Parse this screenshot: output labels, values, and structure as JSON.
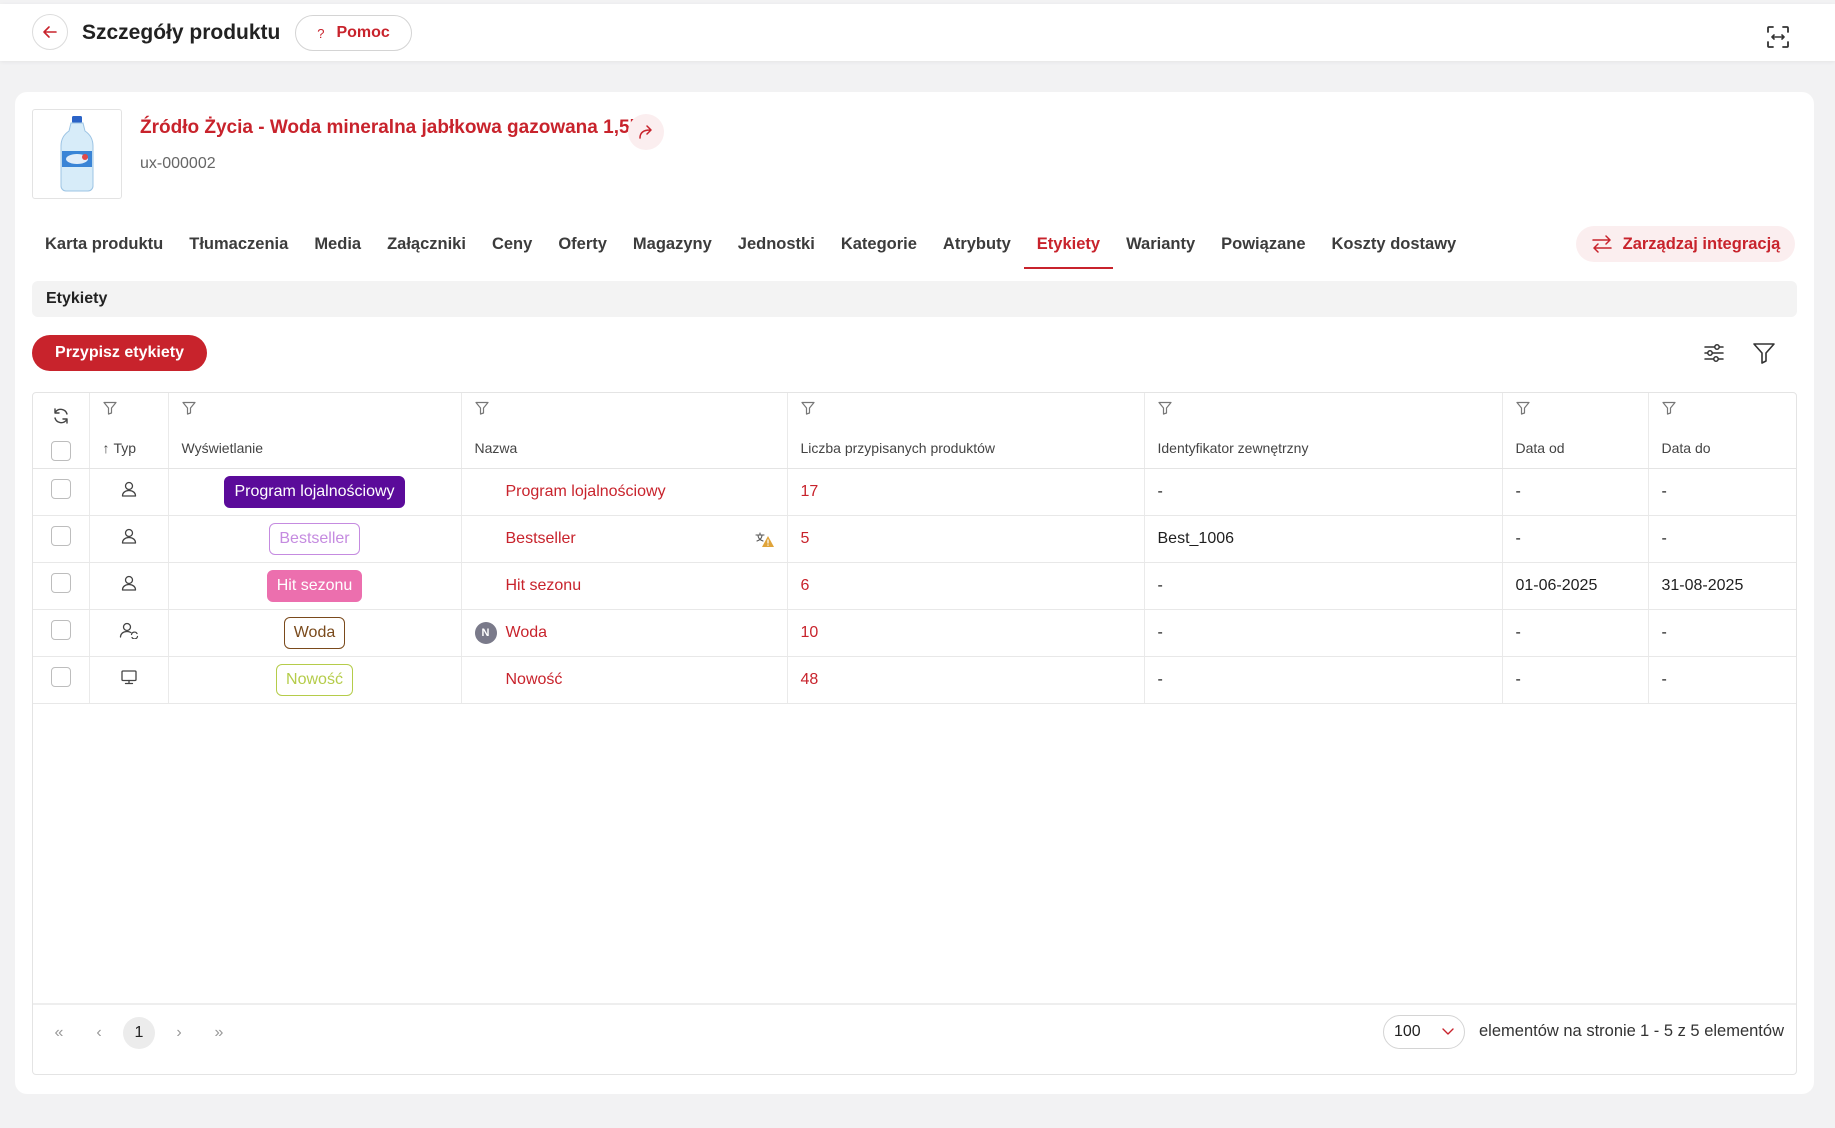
{
  "header": {
    "title": "Szczegóły produktu",
    "help_label": "Pomoc",
    "help_icon": "?"
  },
  "product": {
    "name": "Źródło Życia - Woda mineralna jabłkowa gazowana 1,5l",
    "sku": "ux-000002"
  },
  "tabs": [
    {
      "label": "Karta produktu"
    },
    {
      "label": "Tłumaczenia"
    },
    {
      "label": "Media"
    },
    {
      "label": "Załączniki"
    },
    {
      "label": "Ceny"
    },
    {
      "label": "Oferty"
    },
    {
      "label": "Magazyny"
    },
    {
      "label": "Jednostki"
    },
    {
      "label": "Kategorie"
    },
    {
      "label": "Atrybuty"
    },
    {
      "label": "Etykiety",
      "active": true
    },
    {
      "label": "Warianty"
    },
    {
      "label": "Powiązane"
    },
    {
      "label": "Koszty dostawy"
    }
  ],
  "integration_label": "Zarządzaj integracją",
  "section_title": "Etykiety",
  "assign_label": "Przypisz etykiety",
  "columns": {
    "type": "Typ",
    "display": "Wyświetlanie",
    "name": "Nazwa",
    "count": "Liczba przypisanych produktów",
    "external_id": "Identyfikator zewnętrzny",
    "date_from": "Data od",
    "date_to": "Data do"
  },
  "rows": [
    {
      "type_icon": "user-icon",
      "display": "Program lojalnościowy",
      "badge": {
        "bg": "#5b0b9a",
        "color": "#ffffff",
        "border": "#5b0b9a"
      },
      "name": "Program lojalnościowy",
      "name_prefix": "",
      "warn": false,
      "count": "17",
      "external_id": "-",
      "date_from": "-",
      "date_to": "-"
    },
    {
      "type_icon": "user-icon",
      "display": "Bestseller",
      "badge": {
        "bg": "#ffffff",
        "color": "#c58be0",
        "border": "#c58be0"
      },
      "name": "Bestseller",
      "name_prefix": "",
      "warn": true,
      "count": "5",
      "external_id": "Best_1006",
      "date_from": "-",
      "date_to": "-"
    },
    {
      "type_icon": "user-icon",
      "display": "Hit sezonu",
      "badge": {
        "bg": "#ec6fae",
        "color": "#ffffff",
        "border": "#ec6fae"
      },
      "name": "Hit sezonu",
      "name_prefix": "",
      "warn": false,
      "count": "6",
      "external_id": "-",
      "date_from": "01-06-2025",
      "date_to": "31-08-2025"
    },
    {
      "type_icon": "user-sync-icon",
      "display": "Woda",
      "badge": {
        "bg": "#ffffff",
        "color": "#7a4a1c",
        "border": "#7a4a1c"
      },
      "name": "Woda",
      "name_prefix": "N",
      "warn": false,
      "count": "10",
      "external_id": "-",
      "date_from": "-",
      "date_to": "-"
    },
    {
      "type_icon": "monitor-icon",
      "display": "Nowość",
      "badge": {
        "bg": "#ffffff",
        "color": "#b5cc4a",
        "border": "#b5cc4a"
      },
      "name": "Nowość",
      "name_prefix": "",
      "warn": false,
      "count": "48",
      "external_id": "-",
      "date_from": "-",
      "date_to": "-"
    }
  ],
  "pager": {
    "current_page": "1",
    "page_size": "100",
    "page_size_label": "elementów na stronie",
    "range": "1 - 5 z 5 elementów"
  },
  "colors": {
    "accent": "#c8232c",
    "accent_soft": "#fbeeef"
  }
}
